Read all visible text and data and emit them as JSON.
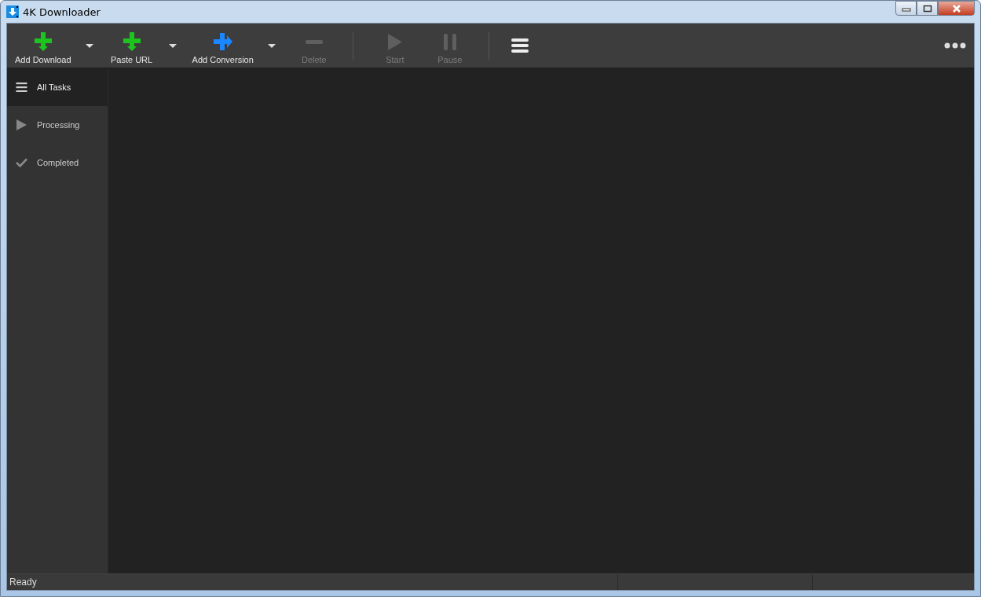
{
  "window": {
    "title": "4K Downloader"
  },
  "toolbar": {
    "groups": [
      [
        {
          "kind": "download",
          "label": "Add Download",
          "disabled": false,
          "dropdown": true
        },
        {
          "kind": "download",
          "label": "Paste URL",
          "disabled": false,
          "dropdown": true
        },
        {
          "kind": "convert",
          "label": "Add Conversion",
          "disabled": false,
          "dropdown": true
        },
        {
          "kind": "delete",
          "label": "Delete",
          "disabled": true,
          "dropdown": false
        }
      ],
      [
        {
          "kind": "start",
          "label": "Start",
          "disabled": true,
          "dropdown": false
        },
        {
          "kind": "pause",
          "label": "Pause",
          "disabled": true,
          "dropdown": false
        }
      ]
    ]
  },
  "sidebar": {
    "items": [
      {
        "kind": "all",
        "label": "All Tasks",
        "selected": true
      },
      {
        "kind": "processing",
        "label": "Processing",
        "selected": false
      },
      {
        "kind": "completed",
        "label": "Completed",
        "selected": false
      }
    ]
  },
  "status_bar": {
    "text": "Ready"
  }
}
